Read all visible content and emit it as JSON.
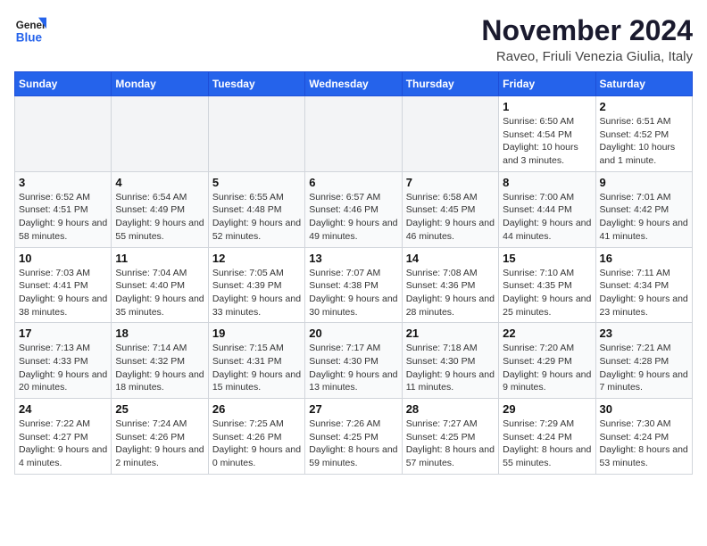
{
  "header": {
    "logo_general": "General",
    "logo_blue": "Blue",
    "title": "November 2024",
    "subtitle": "Raveo, Friuli Venezia Giulia, Italy"
  },
  "weekdays": [
    "Sunday",
    "Monday",
    "Tuesday",
    "Wednesday",
    "Thursday",
    "Friday",
    "Saturday"
  ],
  "weeks": [
    [
      {
        "day": "",
        "info": ""
      },
      {
        "day": "",
        "info": ""
      },
      {
        "day": "",
        "info": ""
      },
      {
        "day": "",
        "info": ""
      },
      {
        "day": "",
        "info": ""
      },
      {
        "day": "1",
        "info": "Sunrise: 6:50 AM\nSunset: 4:54 PM\nDaylight: 10 hours and 3 minutes."
      },
      {
        "day": "2",
        "info": "Sunrise: 6:51 AM\nSunset: 4:52 PM\nDaylight: 10 hours and 1 minute."
      }
    ],
    [
      {
        "day": "3",
        "info": "Sunrise: 6:52 AM\nSunset: 4:51 PM\nDaylight: 9 hours and 58 minutes."
      },
      {
        "day": "4",
        "info": "Sunrise: 6:54 AM\nSunset: 4:49 PM\nDaylight: 9 hours and 55 minutes."
      },
      {
        "day": "5",
        "info": "Sunrise: 6:55 AM\nSunset: 4:48 PM\nDaylight: 9 hours and 52 minutes."
      },
      {
        "day": "6",
        "info": "Sunrise: 6:57 AM\nSunset: 4:46 PM\nDaylight: 9 hours and 49 minutes."
      },
      {
        "day": "7",
        "info": "Sunrise: 6:58 AM\nSunset: 4:45 PM\nDaylight: 9 hours and 46 minutes."
      },
      {
        "day": "8",
        "info": "Sunrise: 7:00 AM\nSunset: 4:44 PM\nDaylight: 9 hours and 44 minutes."
      },
      {
        "day": "9",
        "info": "Sunrise: 7:01 AM\nSunset: 4:42 PM\nDaylight: 9 hours and 41 minutes."
      }
    ],
    [
      {
        "day": "10",
        "info": "Sunrise: 7:03 AM\nSunset: 4:41 PM\nDaylight: 9 hours and 38 minutes."
      },
      {
        "day": "11",
        "info": "Sunrise: 7:04 AM\nSunset: 4:40 PM\nDaylight: 9 hours and 35 minutes."
      },
      {
        "day": "12",
        "info": "Sunrise: 7:05 AM\nSunset: 4:39 PM\nDaylight: 9 hours and 33 minutes."
      },
      {
        "day": "13",
        "info": "Sunrise: 7:07 AM\nSunset: 4:38 PM\nDaylight: 9 hours and 30 minutes."
      },
      {
        "day": "14",
        "info": "Sunrise: 7:08 AM\nSunset: 4:36 PM\nDaylight: 9 hours and 28 minutes."
      },
      {
        "day": "15",
        "info": "Sunrise: 7:10 AM\nSunset: 4:35 PM\nDaylight: 9 hours and 25 minutes."
      },
      {
        "day": "16",
        "info": "Sunrise: 7:11 AM\nSunset: 4:34 PM\nDaylight: 9 hours and 23 minutes."
      }
    ],
    [
      {
        "day": "17",
        "info": "Sunrise: 7:13 AM\nSunset: 4:33 PM\nDaylight: 9 hours and 20 minutes."
      },
      {
        "day": "18",
        "info": "Sunrise: 7:14 AM\nSunset: 4:32 PM\nDaylight: 9 hours and 18 minutes."
      },
      {
        "day": "19",
        "info": "Sunrise: 7:15 AM\nSunset: 4:31 PM\nDaylight: 9 hours and 15 minutes."
      },
      {
        "day": "20",
        "info": "Sunrise: 7:17 AM\nSunset: 4:30 PM\nDaylight: 9 hours and 13 minutes."
      },
      {
        "day": "21",
        "info": "Sunrise: 7:18 AM\nSunset: 4:30 PM\nDaylight: 9 hours and 11 minutes."
      },
      {
        "day": "22",
        "info": "Sunrise: 7:20 AM\nSunset: 4:29 PM\nDaylight: 9 hours and 9 minutes."
      },
      {
        "day": "23",
        "info": "Sunrise: 7:21 AM\nSunset: 4:28 PM\nDaylight: 9 hours and 7 minutes."
      }
    ],
    [
      {
        "day": "24",
        "info": "Sunrise: 7:22 AM\nSunset: 4:27 PM\nDaylight: 9 hours and 4 minutes."
      },
      {
        "day": "25",
        "info": "Sunrise: 7:24 AM\nSunset: 4:26 PM\nDaylight: 9 hours and 2 minutes."
      },
      {
        "day": "26",
        "info": "Sunrise: 7:25 AM\nSunset: 4:26 PM\nDaylight: 9 hours and 0 minutes."
      },
      {
        "day": "27",
        "info": "Sunrise: 7:26 AM\nSunset: 4:25 PM\nDaylight: 8 hours and 59 minutes."
      },
      {
        "day": "28",
        "info": "Sunrise: 7:27 AM\nSunset: 4:25 PM\nDaylight: 8 hours and 57 minutes."
      },
      {
        "day": "29",
        "info": "Sunrise: 7:29 AM\nSunset: 4:24 PM\nDaylight: 8 hours and 55 minutes."
      },
      {
        "day": "30",
        "info": "Sunrise: 7:30 AM\nSunset: 4:24 PM\nDaylight: 8 hours and 53 minutes."
      }
    ]
  ]
}
